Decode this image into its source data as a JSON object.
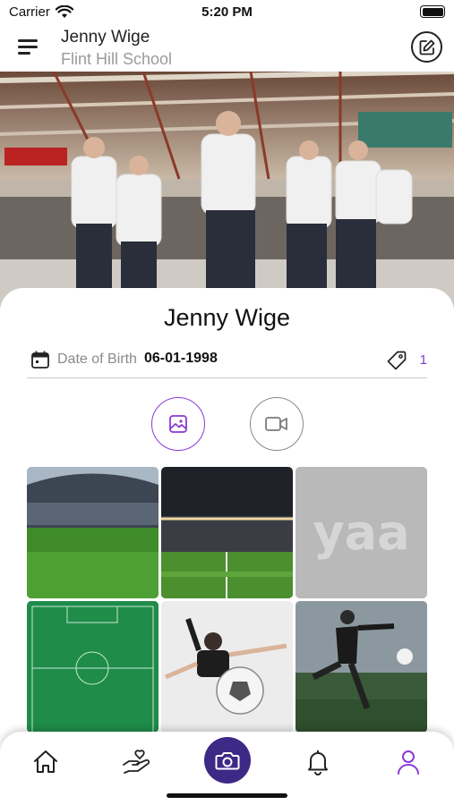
{
  "status_bar": {
    "carrier": "Carrier",
    "time": "5:20 PM"
  },
  "header": {
    "name": "Jenny Wige",
    "school": "Flint Hill School"
  },
  "profile": {
    "name": "Jenny Wige",
    "dob_label": "Date of Birth",
    "dob_value": "06-01-1998",
    "tag_count": "1"
  },
  "media_toggle": {
    "selected": "photos"
  },
  "gallery": [
    "stadium-wide",
    "stadium-night-field",
    "yaa-placeholder",
    "green-field-top-view",
    "goalkeeper-with-ball",
    "player-kicking-ball"
  ],
  "placeholder_logo_text": "yaa",
  "bottom_nav": {
    "items": [
      "home-icon",
      "heart-hand-icon",
      "camera-icon",
      "bell-icon",
      "user-icon"
    ],
    "active": "user-icon"
  },
  "colors": {
    "accent": "#8a3ad6",
    "fab": "#3c2a86",
    "muted": "#8a8a8a"
  }
}
